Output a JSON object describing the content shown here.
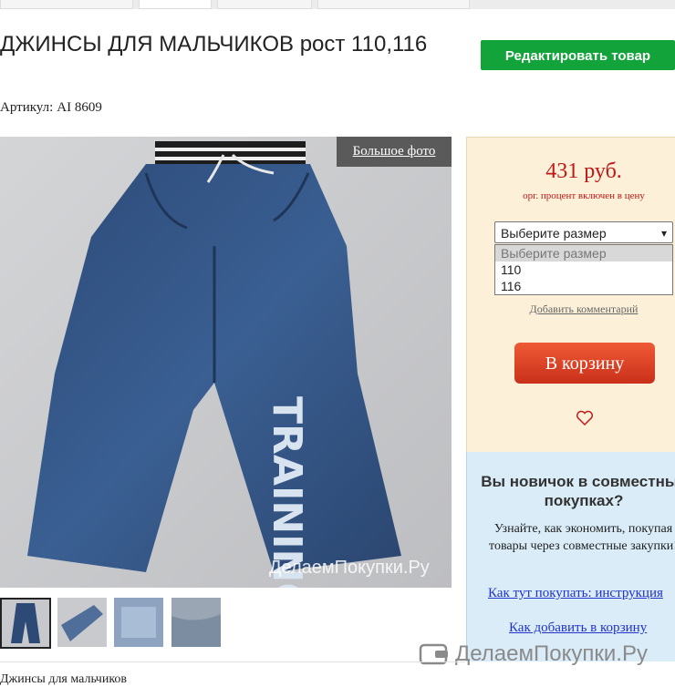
{
  "product": {
    "title": "ДЖИНСЫ ДЛЯ МАЛЬЧИКОВ рост 110,116",
    "sku_label": "Артикул:",
    "sku_value": "AI 8609",
    "edit_label": "Редактировать товар",
    "big_photo_label": "Большое фото",
    "photo_watermark": "ДелаемПокупки.Ру",
    "jeans_print": "TRAINING",
    "description": "Джинсы для мальчиков"
  },
  "purchase": {
    "price": "431 руб.",
    "price_note": "орг. процент включен в цену",
    "size_select": {
      "selected": "Выберите размер",
      "options": [
        "Выберите размер",
        "110",
        "116"
      ]
    },
    "comment_link": "Добавить комментарий",
    "cart_label": "В корзину",
    "favorite_icon": "heart-icon"
  },
  "info": {
    "title": "Вы новичок в совместных покупках?",
    "text": "Узнайте, как экономить, покупая товары через совместные закупки!",
    "link_howto": "Как тут покупать: инструкция",
    "link_add": "Как добавить в корзину"
  },
  "brand": {
    "name": "ДелаемПокупки.Ру",
    "icon": "wallet-icon"
  },
  "colors": {
    "edit_button": "#12a33a",
    "price": "#c01818",
    "cart_button": "#d93a1c",
    "price_box": "#fcf1d8",
    "info_box": "#d9ecf8",
    "link": "#2233cc"
  }
}
